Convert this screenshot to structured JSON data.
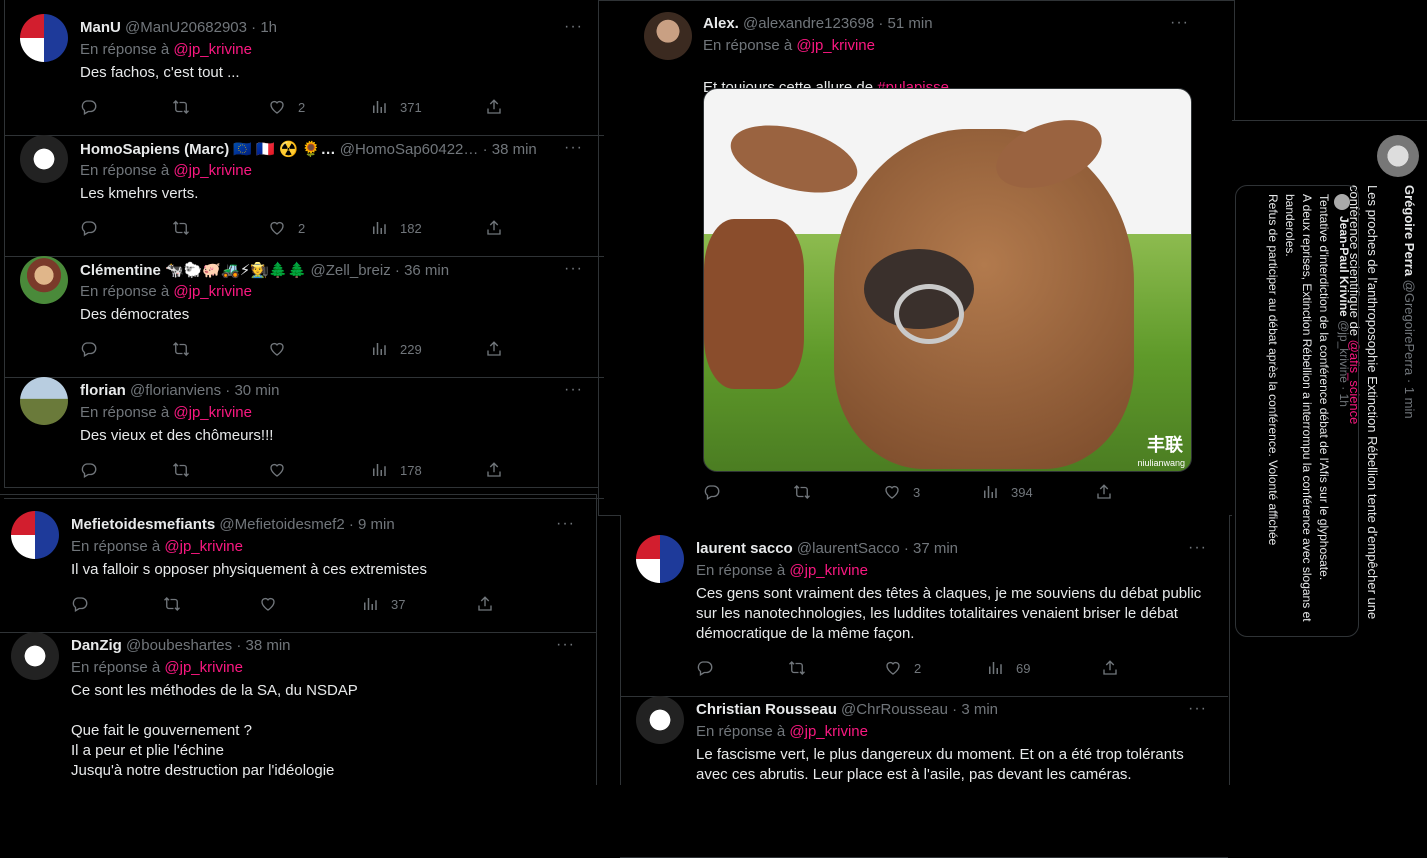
{
  "reply_prefix": "En réponse à",
  "more": "···",
  "left_tweets": [
    {
      "name": "ManU",
      "handle": "@ManU20682903",
      "time": "· 1h",
      "mention": "@jp_krivine",
      "text": "Des fachos, c'est tout ...",
      "likes": "2",
      "views": "371",
      "avatar": "flag-avatar"
    },
    {
      "name": "HomoSapiens (Marc) 🇪🇺 🇫🇷 ☢️ 🌻…",
      "handle": "@HomoSap60422…",
      "time": "· 38 min",
      "mention": "@jp_krivine",
      "text": "Les kmehrs verts.",
      "likes": "2",
      "views": "182",
      "avatar": "logo-avatar"
    },
    {
      "name": "Clémentine 🐄🐑🐖🚜⚡🧑‍🌾🌲🌲",
      "handle": "@Zell_breiz",
      "time": "· 36 min",
      "mention": "@jp_krivine",
      "text": "Des démocrates",
      "likes": "",
      "views": "229",
      "avatar": "portrait-avatar"
    },
    {
      "name": "florian",
      "handle": "@florianviens",
      "time": "· 30 min",
      "mention": "@jp_krivine",
      "text": "Des vieux et des chômeurs!!!",
      "likes": "",
      "views": "178",
      "avatar": "landscape-avatar"
    }
  ],
  "lower_left_tweets": [
    {
      "name": "Mefietoidesmefiants",
      "handle": "@Mefietoidesmef2",
      "time": "· 9 min",
      "mention": "@jp_krivine",
      "text": "Il va falloir s opposer physiquement à ces extremistes",
      "likes": "",
      "views": "37"
    },
    {
      "name": "DanZig",
      "handle": "@boubeshartes",
      "time": "· 38 min",
      "mention": "@jp_krivine",
      "text": "Ce sont les méthodes de la SA, du NSDAP\n\nQue fait le gouvernement ?\nIl a peur et plie l'échine\nJusqu'à notre destruction par l'idéologie"
    }
  ],
  "center_tweet": {
    "name": "Alex.",
    "handle": "@alexandre123698",
    "time": "· 51 min",
    "mention": "@jp_krivine",
    "text_prefix": "Et toujours cette allure de ",
    "hashtag": "#pulapisse",
    "text_suffix": " .",
    "likes": "3",
    "views": "394",
    "watermark": "丰联",
    "watermark_sub": "niulianwang"
  },
  "right_tweets": [
    {
      "name": "laurent sacco",
      "handle": "@laurentSacco",
      "time": "· 37 min",
      "mention": "@jp_krivine",
      "text": "Ces gens sont vraiment des têtes à claques, je me souviens du débat public sur les nanotechnologies, les luddites totalitaires venaient briser le débat démocratique de la même façon.",
      "likes": "2",
      "views": "69"
    },
    {
      "name": "Christian Rousseau",
      "handle": "@ChrRousseau",
      "time": "· 3 min",
      "mention": "@jp_krivine",
      "text": "Le fascisme vert, le plus dangereux du moment. Et on a été trop tolérants avec ces abrutis. Leur place est à l'asile, pas devant les caméras."
    }
  ],
  "rotated_tweet": {
    "name": "Grégoire Perra",
    "handle": "@GregoirePerra",
    "time": "· 1 min",
    "text_prefix": "Les proches de l'anthroposophie Extinction Rébellion tente d'empêcher une conférence scientifique de ",
    "mention": "@afis_science",
    "quote": {
      "name": "Jean-Paul Krivine",
      "handle": "@jp_krivine",
      "time": "· 1h",
      "text": "Tentative d'interdiction de la conférence débat de l'Afis sur le glyphosate.\nA deux reprises, Extinction Rébellion a interrompu la conférence avec slogans et banderoles.\nRefus de participer au débat après la conférence. Volonté affichée"
    }
  }
}
